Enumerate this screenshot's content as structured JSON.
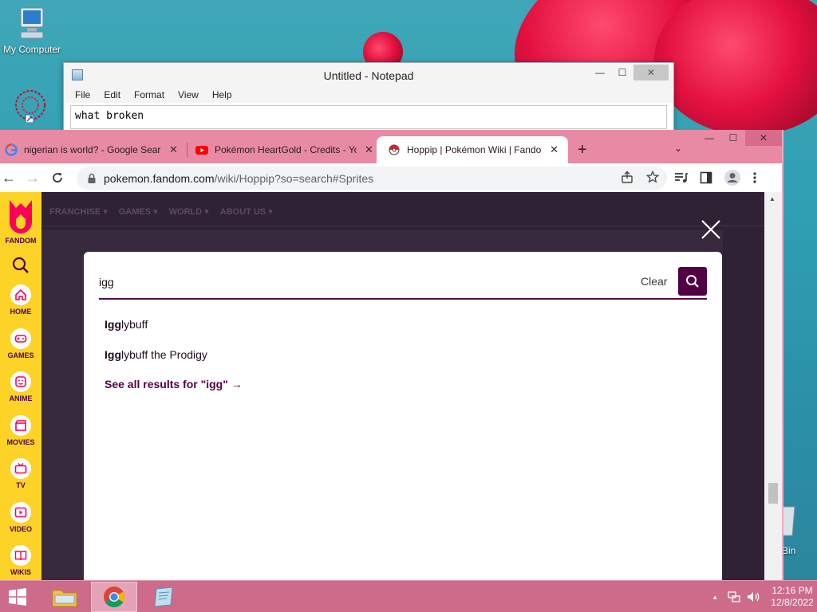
{
  "desktop": {
    "icons": [
      {
        "label": "My Computer"
      },
      {
        "label": "Bin"
      }
    ]
  },
  "notepad": {
    "title": "Untitled - Notepad",
    "menu": [
      "File",
      "Edit",
      "Format",
      "View",
      "Help"
    ],
    "content": "what broken",
    "minimize_glyph": "—",
    "maximize_glyph": "☐",
    "close_glyph": "✕"
  },
  "browser": {
    "tabs": [
      {
        "title": "nigerian is world? - Google Search",
        "close": "✕",
        "icon": "google-icon"
      },
      {
        "title": "Pokémon HeartGold - Credits - YouTube",
        "close": "✕",
        "icon": "youtube-icon"
      },
      {
        "title": "Hoppip | Pokémon Wiki | Fandom",
        "close": "✕",
        "icon": "pokeball-icon"
      }
    ],
    "new_tab_glyph": "+",
    "tab_menu_glyph": "⌄",
    "window_controls": {
      "minimize": "—",
      "maximize": "☐",
      "close": "✕"
    },
    "url": {
      "host": "pokemon.fandom.com",
      "path": "/wiki/Hoppip?so=search#Sprites"
    },
    "accent": "#e98aa5"
  },
  "fandom": {
    "logo_label": "FANDOM",
    "rail": [
      {
        "label": "HOME"
      },
      {
        "label": "GAMES"
      },
      {
        "label": "ANIME"
      },
      {
        "label": "MOVIES"
      },
      {
        "label": "TV"
      },
      {
        "label": "VIDEO"
      },
      {
        "label": "WIKIS"
      }
    ],
    "page_nav": [
      "FRANCHISE ▾",
      "GAMES ▾",
      "WORLD ▾",
      "ABOUT US ▾"
    ],
    "search": {
      "query": "igg",
      "clear_label": "Clear",
      "suggestions": [
        {
          "match": "Igg",
          "rest": "lybuff"
        },
        {
          "match": "Igg",
          "rest": "lybuff the Prodigy"
        }
      ],
      "see_all": "See all results for \"igg\" →"
    },
    "brand_color": "#520044",
    "rail_color": "#fdd327"
  },
  "taskbar": {
    "time": "12:16 PM",
    "date": "12/8/2022",
    "tray_up": "▲"
  }
}
